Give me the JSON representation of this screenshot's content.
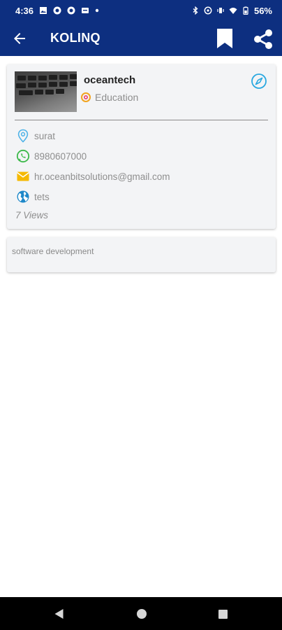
{
  "status_bar": {
    "time": "4:36",
    "battery": "56%"
  },
  "app_bar": {
    "title": "KOLINQ",
    "icons": [
      "back-arrow-icon",
      "bookmark-icon",
      "share-icon"
    ]
  },
  "business": {
    "name": "oceantech",
    "category": "Education",
    "location": "surat",
    "phone": "8980607000",
    "email": "hr.oceanbitsolutions@gmail.com",
    "website": "tets",
    "views": "7 Views",
    "description": "software development"
  },
  "colors": {
    "primary": "#0d2f80",
    "card_background": "#f3f4f6",
    "location_icon": "#4fb3e8",
    "phone_icon": "#3cb94a",
    "email_icon": "#f5b900",
    "web_icon": "#1e88c9",
    "compass_icon": "#29a8e0"
  }
}
